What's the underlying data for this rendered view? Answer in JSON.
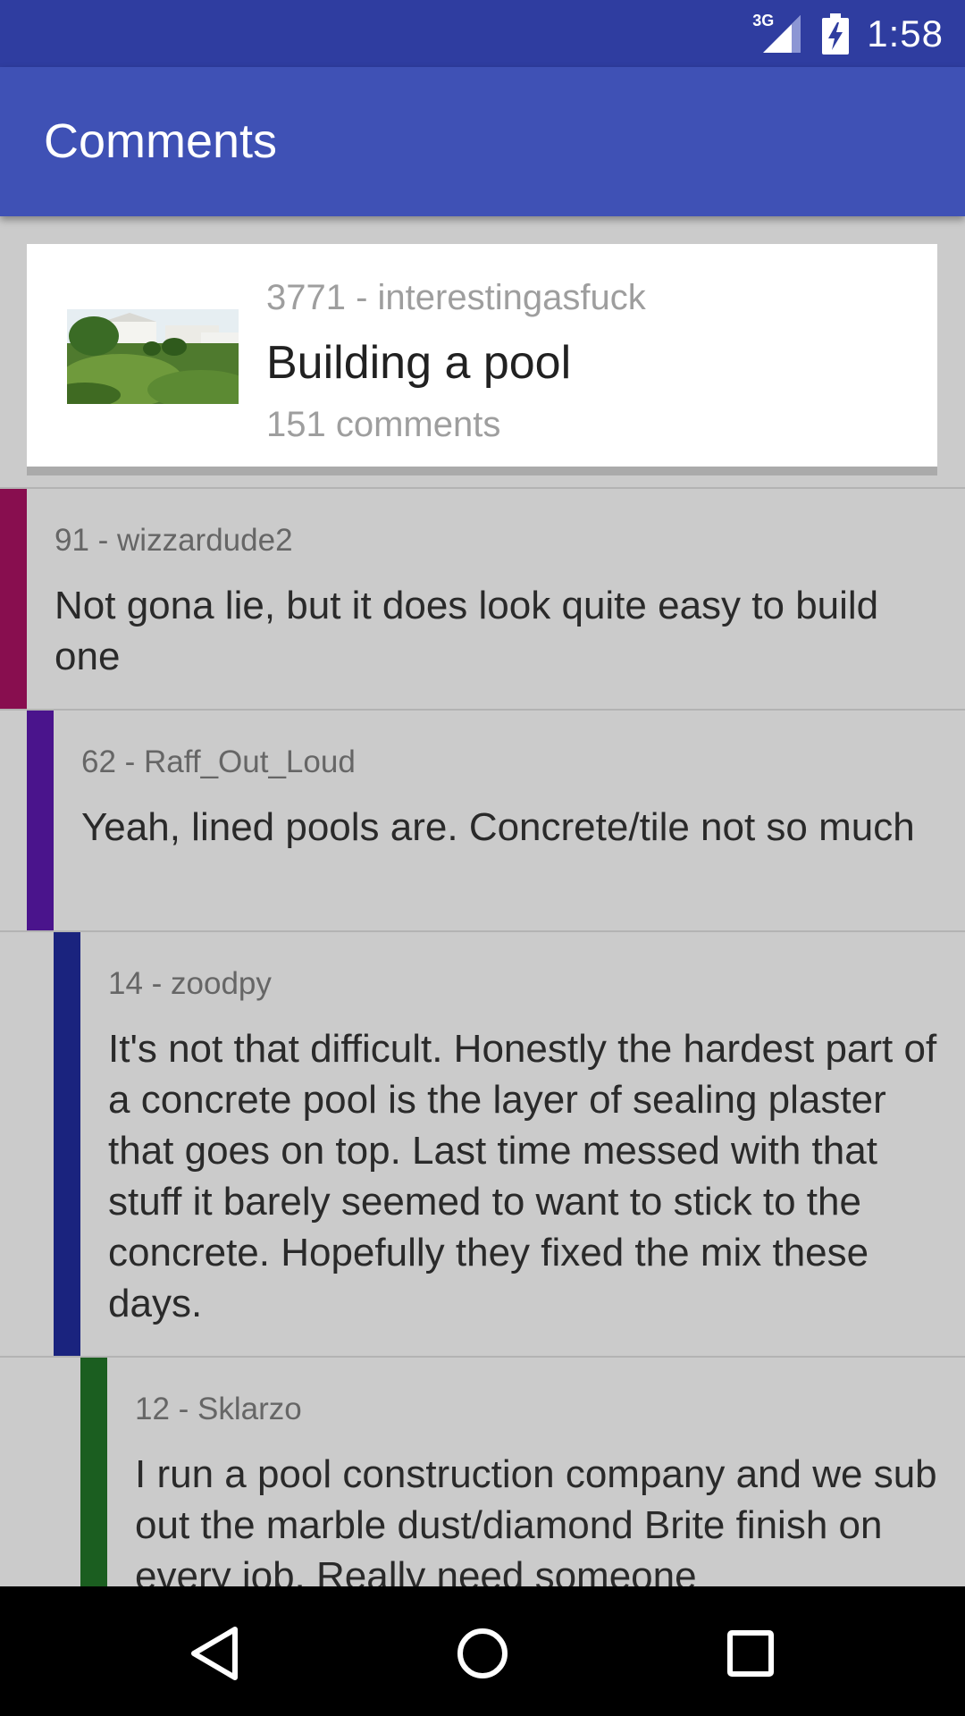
{
  "status_bar": {
    "network_label": "3G",
    "time": "1:58",
    "icons": [
      "signal-icon",
      "battery-charging-icon"
    ]
  },
  "app_bar": {
    "title": "Comments"
  },
  "post": {
    "meta": "3771 - interestingasfuck",
    "title": "Building a pool",
    "comment_count": "151 comments",
    "thumbnail": "backyard-thumbnail"
  },
  "comments": [
    {
      "meta": "91 - wizzardude2",
      "body": "Not gona lie, but it does look quite easy to build one",
      "depth": 0,
      "color": "#880e4f"
    },
    {
      "meta": "62 - Raff_Out_Loud",
      "body": "Yeah, lined pools are. Concrete/tile not so much",
      "depth": 1,
      "color": "#4a148c"
    },
    {
      "meta": "14 - zoodpy",
      "body": "It's not that difficult.  Honestly the hardest part of a concrete pool is the layer of sealing plaster that goes on top.  Last time messed with that stuff it barely seemed to want to stick to the concrete.  Hopefully they fixed the mix these days.",
      "depth": 2,
      "color": "#1a237e"
    },
    {
      "meta": "12 - Sklarzo",
      "body": "I run a pool construction company and we sub out the marble dust/diamond Brite finish on every job. Really need someone",
      "depth": 3,
      "color": "#1b5e20"
    }
  ],
  "nav_bar": {
    "icons": [
      "back-icon",
      "home-icon",
      "recents-icon"
    ]
  }
}
